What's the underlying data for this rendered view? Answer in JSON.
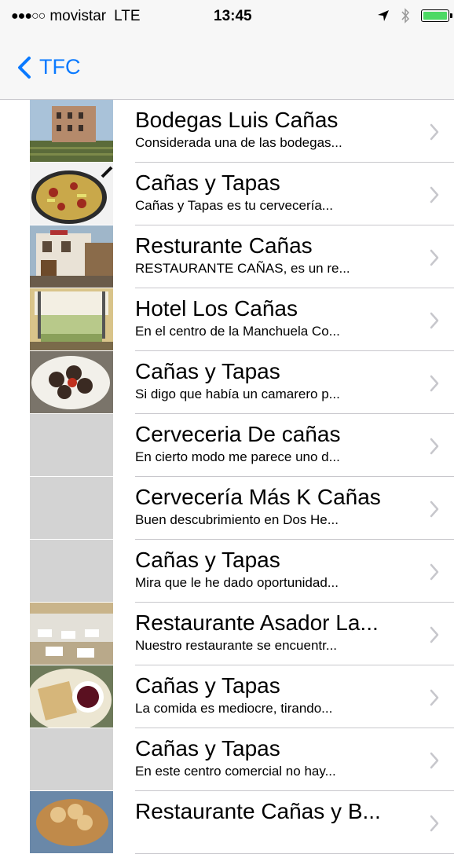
{
  "status": {
    "signal": "●●●○○",
    "carrier": "movistar",
    "network": "LTE",
    "time": "13:45",
    "battery_color": "#4cd964"
  },
  "nav": {
    "back_label": "TFC",
    "accent_color": "#0a7aff"
  },
  "rows": [
    {
      "title": "Bodegas Luis Cañas",
      "subtitle": "Considerada una de las bodegas...",
      "image": "building-photo"
    },
    {
      "title": "Cañas y Tapas",
      "subtitle": "Cañas y Tapas es tu cervecería...",
      "image": "paella-photo"
    },
    {
      "title": "Resturante Cañas",
      "subtitle": "RESTAURANTE CAÑAS, es un re...",
      "image": "restaurant-facade-photo"
    },
    {
      "title": "Hotel Los Cañas",
      "subtitle": "En el centro de la Manchuela Co...",
      "image": "hotel-room-photo"
    },
    {
      "title": "Cañas y Tapas",
      "subtitle": "Si digo que había un camarero p...",
      "image": "food-plate-photo"
    },
    {
      "title": "Cerveceria De cañas",
      "subtitle": "En cierto modo me parece uno d...",
      "image": "placeholder"
    },
    {
      "title": "Cervecería Más K Cañas",
      "subtitle": "Buen descubrimiento en Dos He...",
      "image": "placeholder"
    },
    {
      "title": "Cañas y Tapas",
      "subtitle": "Mira que le he dado oportunidad...",
      "image": "placeholder"
    },
    {
      "title": "Restaurante Asador La...",
      "subtitle": "Nuestro restaurante se encuentr...",
      "image": "dining-hall-photo"
    },
    {
      "title": "Cañas y Tapas",
      "subtitle": "La comida es mediocre, tirando...",
      "image": "bread-plate-photo"
    },
    {
      "title": "Cañas y Tapas",
      "subtitle": "En este centro comercial no hay...",
      "image": "placeholder"
    },
    {
      "title": "Restaurante Cañas y B...",
      "subtitle": "",
      "image": "bread-basket-photo"
    }
  ]
}
